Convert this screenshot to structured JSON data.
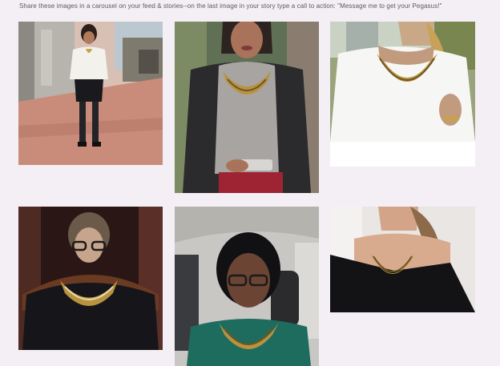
{
  "instruction": "Share these images in a carousel on your feed & stories--on the last image in your story type a call to action: \"Message me to get your Pegasus!\"",
  "gallery": {
    "photos": [
      {
        "subject": "woman in white blouse and black skirt walking on brick sidewalk"
      },
      {
        "subject": "woman in grey top and leather jacket wearing gold collar necklace"
      },
      {
        "subject": "woman in white t-shirt wearing gold fringe necklace"
      },
      {
        "subject": "woman in judicial robe wearing gold collar necklace"
      },
      {
        "subject": "woman with glasses taking selfie in car wearing gold necklace"
      },
      {
        "subject": "woman in black off-shoulder top wearing gold collar necklace"
      }
    ]
  },
  "colors": {
    "background": "#f4eff5",
    "necklace_gold": "#b8923f",
    "text": "#5a5a5a"
  }
}
